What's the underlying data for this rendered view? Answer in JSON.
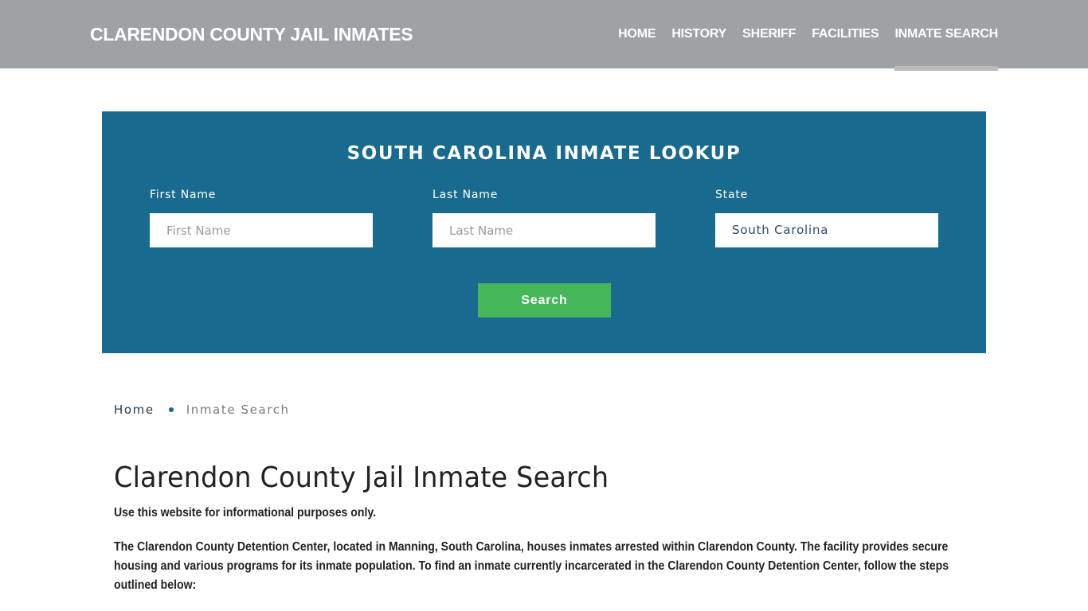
{
  "header": {
    "brand": "CLARENDON COUNTY JAIL INMATES",
    "nav": [
      {
        "label": "HOME",
        "active": false
      },
      {
        "label": "HISTORY",
        "active": false
      },
      {
        "label": "SHERIFF",
        "active": false
      },
      {
        "label": "FACILITIES",
        "active": false
      },
      {
        "label": "INMATE SEARCH",
        "active": true
      }
    ]
  },
  "lookup": {
    "title": "SOUTH CAROLINA INMATE LOOKUP",
    "first_name": {
      "label": "First Name",
      "placeholder": "First Name",
      "value": ""
    },
    "last_name": {
      "label": "Last Name",
      "placeholder": "Last Name",
      "value": ""
    },
    "state": {
      "label": "State",
      "selected": "South Carolina"
    },
    "search_label": "Search",
    "background_color": "#186a8e",
    "button_color": "#45b759"
  },
  "breadcrumb": {
    "home": "Home",
    "current": "Inmate Search"
  },
  "content": {
    "title": "Clarendon County Jail Inmate Search",
    "intro": "Use this website for informational purposes only.",
    "paragraph": "The Clarendon County Detention Center, located in Manning, South Carolina, houses inmates arrested within Clarendon County. The facility provides secure housing and various programs for its inmate population. To find an inmate currently incarcerated in the Clarendon County Detention Center, follow the steps outlined below:"
  }
}
